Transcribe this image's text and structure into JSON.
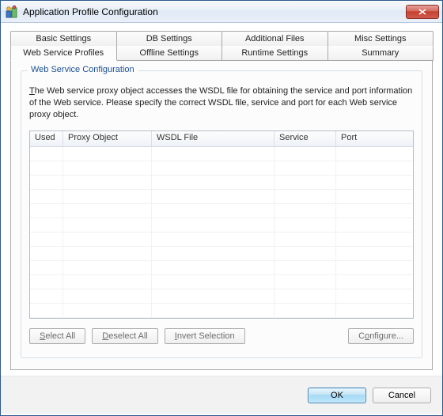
{
  "window": {
    "title": "Application Profile Configuration"
  },
  "tabs": {
    "row1": [
      "Basic Settings",
      "DB Settings",
      "Additional Files",
      "Misc Settings"
    ],
    "row2": [
      "Web Service Profiles",
      "Offline Settings",
      "Runtime Settings",
      "Summary"
    ],
    "active": "Web Service Profiles"
  },
  "group": {
    "title": "Web Service Configuration",
    "desc_prefix_char": "T",
    "desc_rest": "he Web service proxy object accesses the WSDL file for obtaining the service and port information of the Web service.  Please specify the correct WSDL file, service and port for each Web service proxy object."
  },
  "grid": {
    "columns": [
      "Used",
      "Proxy Object",
      "WSDL File",
      "Service",
      "Port"
    ],
    "rows": []
  },
  "buttons": {
    "select_all": "Select All",
    "select_all_u": "S",
    "deselect_all": "Deselect All",
    "deselect_all_u": "D",
    "invert": "Invert Selection",
    "invert_u": "I",
    "configure": "Configure...",
    "configure_u": "o"
  },
  "footer": {
    "ok": "OK",
    "cancel": "Cancel"
  }
}
